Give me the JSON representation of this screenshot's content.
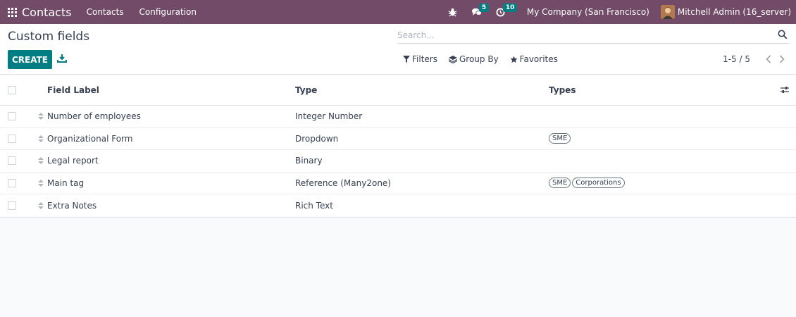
{
  "navbar": {
    "app_name": "Contacts",
    "menus": [
      "Contacts",
      "Configuration"
    ],
    "messages_count": "5",
    "activities_count": "10",
    "company": "My Company (San Francisco)",
    "user": "Mitchell Admin (16_server)"
  },
  "control": {
    "title": "Custom fields",
    "create_label": "CREATE",
    "search_placeholder": "Search...",
    "filters_label": "Filters",
    "groupby_label": "Group By",
    "favorites_label": "Favorites",
    "pager": "1-5 / 5"
  },
  "table": {
    "headers": {
      "label": "Field Label",
      "type": "Type",
      "types": "Types"
    },
    "rows": [
      {
        "label": "Number of employees",
        "type": "Integer Number",
        "tags": []
      },
      {
        "label": "Organizational Form",
        "type": "Dropdown",
        "tags": [
          "SME"
        ]
      },
      {
        "label": "Legal report",
        "type": "Binary",
        "tags": []
      },
      {
        "label": "Main tag",
        "type": "Reference (Many2one)",
        "tags": [
          "SME",
          "Corporations"
        ]
      },
      {
        "label": "Extra Notes",
        "type": "Rich Text",
        "tags": []
      }
    ]
  },
  "colors": {
    "navbar": "#714b67",
    "primary": "#017e84"
  },
  "icons": [
    "apps-icon",
    "bug-icon",
    "chat-icon",
    "clock-icon",
    "download-icon",
    "search-icon",
    "filter-icon",
    "layers-icon",
    "star-icon",
    "chevron-left-icon",
    "chevron-right-icon",
    "drag-handle-icon",
    "column-options-icon"
  ]
}
